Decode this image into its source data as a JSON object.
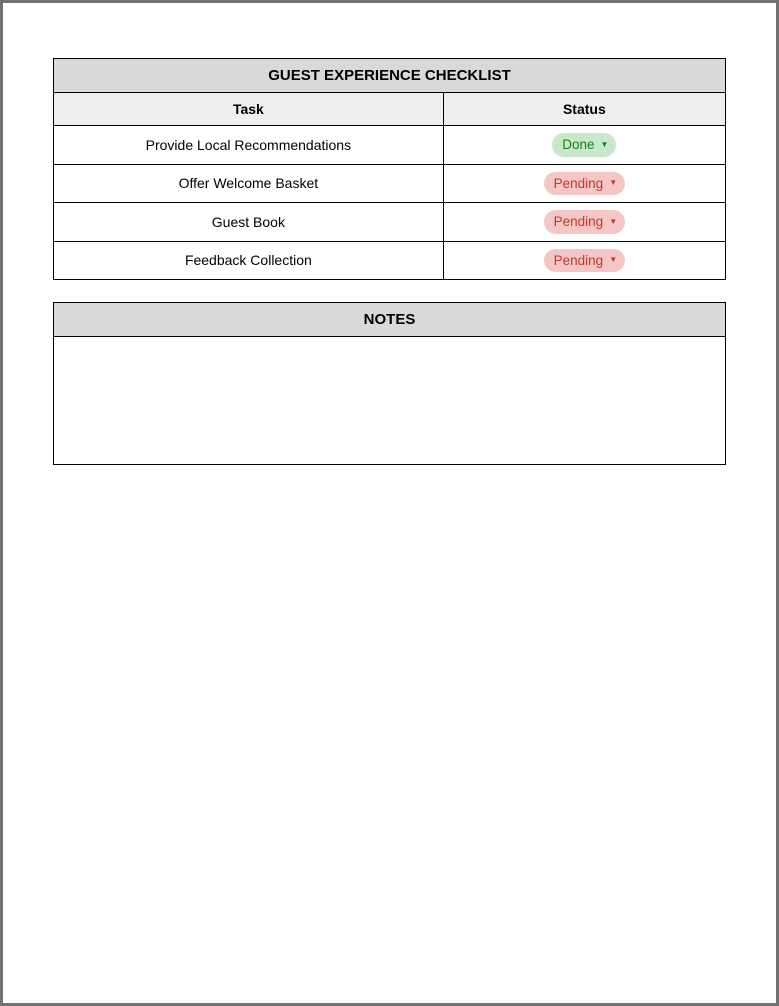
{
  "checklist": {
    "title": "GUEST EXPERIENCE CHECKLIST",
    "columns": {
      "task": "Task",
      "status": "Status"
    },
    "rows": [
      {
        "task": "Provide Local Recommendations",
        "status": "Done",
        "status_type": "done"
      },
      {
        "task": "Offer Welcome Basket",
        "status": "Pending",
        "status_type": "pending"
      },
      {
        "task": "Guest Book",
        "status": "Pending",
        "status_type": "pending"
      },
      {
        "task": "Feedback Collection",
        "status": "Pending",
        "status_type": "pending"
      }
    ]
  },
  "notes": {
    "title": "NOTES",
    "content": ""
  }
}
